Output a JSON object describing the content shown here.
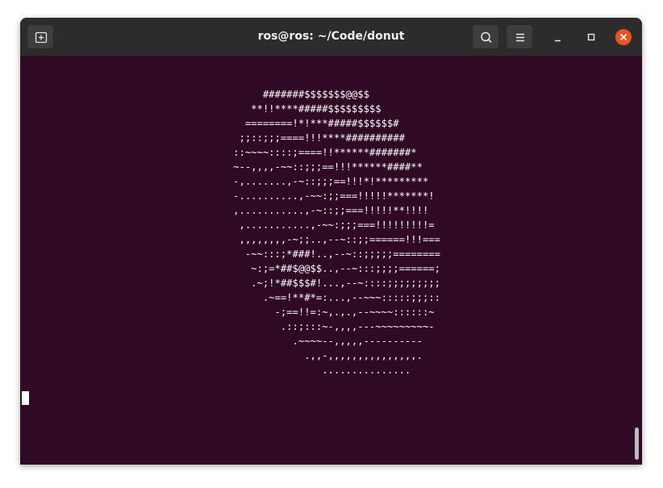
{
  "window": {
    "title": "ros@ros: ~/Code/donut"
  },
  "icons": {
    "new_tab": "new-tab-icon",
    "search": "search-icon",
    "menu": "hamburger-menu-icon",
    "minimize": "minimize-icon",
    "maximize": "maximize-icon",
    "close": "close-icon"
  },
  "colors": {
    "terminal_bg": "#300a24",
    "titlebar_bg": "#2c2c2c",
    "close_accent": "#e95420",
    "text": "#ffffff"
  },
  "terminal": {
    "output": "                                         #######$$$$$$$@@$$\n                                       **!!****#####$$$$$$$$$\n                                      ========!*!***#####$$$$$$#\n                                     ;;::;;;====!!!****##########\n                                    ::~~~~::::;====!!******#######*\n                                    ~--,,,,-~~::;;;==!!!******####**\n                                    -,.......,-~::;;;==!!!*!*********\n                                    -..........,-~~:;;===!!!!!*******!\n                                    ,...........,-~::;;===!!!!!**!!!!\n                                     ,...........,-~~:;;;===!!!!!!!!!=\n                                     ,,,,,,,,-~;;..,--~::;;======!!!===\n                                      -~~:::;*###!..,--~::;;;;;========\n                                       ~:;=*##$@@$$..,--~:::;;;;======;\n                                       .~;!*##$$$#!...,--~::::;;;;;;;;;\n                                         .~==!**#*=:...,--~~~:::::;;;::\n                                           -;==!!=:~,.,.,--~~~~::::::~\n                                            .::;:::~-,,,,---~~~~~~~~~-\n                                              .~~~~--,,,,,----------\n                                                .,,-,,,,,,,,,,,,,,,.\n                                                   ..............."
  }
}
